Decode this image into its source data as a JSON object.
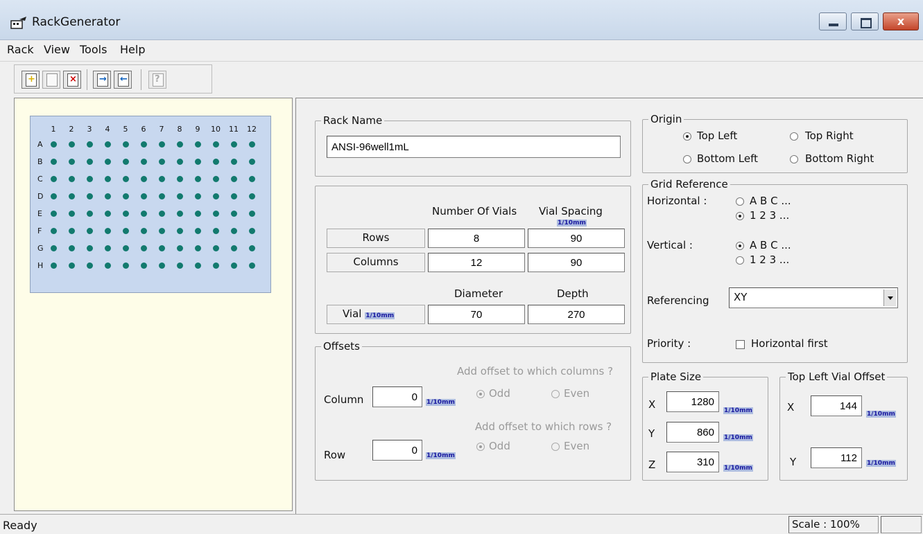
{
  "window": {
    "title": "RackGenerator",
    "close_glyph": "x"
  },
  "menu": [
    "Rack",
    "View",
    "Tools",
    "Help"
  ],
  "toolbar": {
    "icons": [
      "new-rack-icon",
      "open-rack-icon",
      "delete-rack-icon",
      "export-icon",
      "import-icon",
      "help-icon"
    ],
    "help_glyph": "?"
  },
  "plate": {
    "columns": [
      "1",
      "2",
      "3",
      "4",
      "5",
      "6",
      "7",
      "8",
      "9",
      "10",
      "11",
      "12"
    ],
    "rows": [
      "A",
      "B",
      "C",
      "D",
      "E",
      "F",
      "G",
      "H"
    ],
    "well_color": "#127a6e",
    "plate_color": "#c8d8ef"
  },
  "rack_name": {
    "legend": "Rack Name",
    "value": "ANSI-96well1mL"
  },
  "vials": {
    "header_count": "Number Of Vials",
    "header_spacing": "Vial Spacing",
    "unit": "1/10mm",
    "rows_label": "Rows",
    "rows_count": "8",
    "rows_spacing": "90",
    "columns_label": "Columns",
    "columns_count": "12",
    "columns_spacing": "90",
    "header_diameter": "Diameter",
    "header_depth": "Depth",
    "vial_label": "Vial",
    "diameter": "70",
    "depth": "270"
  },
  "offsets": {
    "legend": "Offsets",
    "column_label": "Column",
    "column_value": "0",
    "column_question": "Add offset to which columns ?",
    "row_label": "Row",
    "row_value": "0",
    "row_question": "Add offset to which rows ?",
    "odd": "Odd",
    "even": "Even"
  },
  "origin": {
    "legend": "Origin",
    "top_left": "Top Left",
    "top_right": "Top Right",
    "bottom_left": "Bottom Left",
    "bottom_right": "Bottom Right",
    "selected": "top_left"
  },
  "grid_reference": {
    "legend": "Grid Reference",
    "horizontal_label": "Horizontal :",
    "vertical_label": "Vertical :",
    "letters": "A  B  C ...",
    "numbers": "1  2  3 ...",
    "horizontal_selected": "numbers",
    "vertical_selected": "letters",
    "referencing_label": "Referencing",
    "referencing_value": "XY",
    "priority_label": "Priority :",
    "horizontal_first": "Horizontal first",
    "horizontal_first_checked": false
  },
  "plate_size": {
    "legend": "Plate Size",
    "x_label": "X",
    "x": "1280",
    "y_label": "Y",
    "y": "860",
    "z_label": "Z",
    "z": "310"
  },
  "top_left_offset": {
    "legend": "Top Left Vial Offset",
    "x_label": "X",
    "x": "144",
    "y_label": "Y",
    "y": "112"
  },
  "status": {
    "text": "Ready",
    "scale": "Scale : 100%"
  }
}
